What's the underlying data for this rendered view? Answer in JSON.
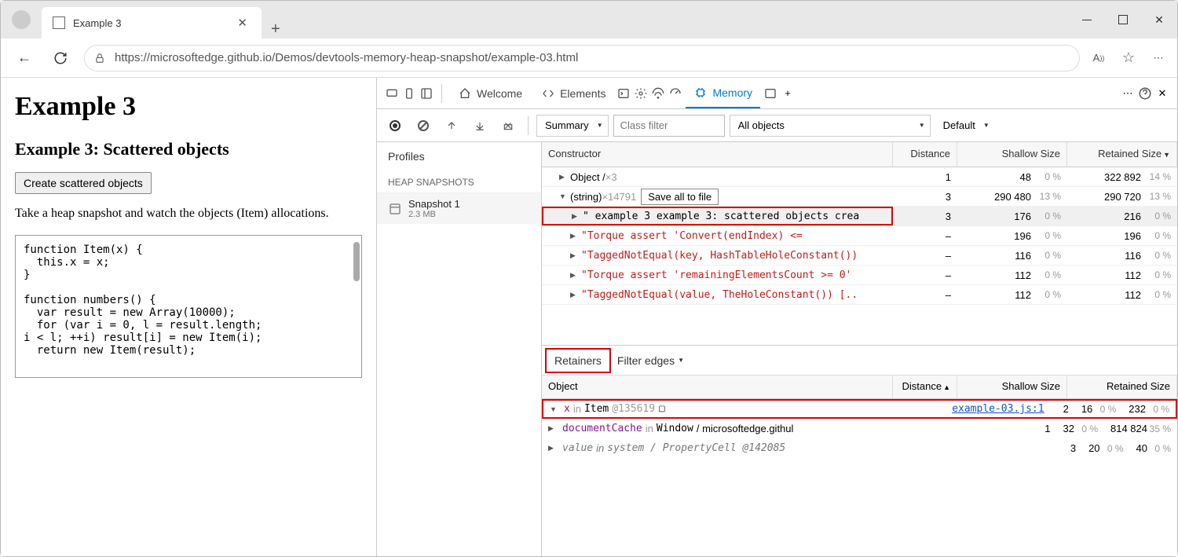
{
  "browser": {
    "tab_title": "Example 3",
    "url": "https://microsoftedge.github.io/Demos/devtools-memory-heap-snapshot/example-03.html"
  },
  "page": {
    "h1": "Example 3",
    "h2": "Example 3: Scattered objects",
    "button": "Create scattered objects",
    "paragraph": "Take a heap snapshot and watch the objects (Item) allocations.",
    "code": "function Item(x) {\n  this.x = x;\n}\n\nfunction numbers() {\n  var result = new Array(10000);\n  for (var i = 0, l = result.length;\ni < l; ++i) result[i] = new Item(i);\n  return new Item(result);"
  },
  "devtools": {
    "tabs": {
      "welcome": "Welcome",
      "elements": "Elements",
      "memory": "Memory"
    },
    "toolbar": {
      "summary": "Summary",
      "class_filter_placeholder": "Class filter",
      "all_objects": "All objects",
      "default": "Default"
    },
    "sidebar": {
      "profiles": "Profiles",
      "section": "HEAP SNAPSHOTS",
      "snapshot_name": "Snapshot 1",
      "snapshot_size": "2.3 MB"
    },
    "heap": {
      "columns": {
        "constructor": "Constructor",
        "distance": "Distance",
        "shallow": "Shallow Size",
        "retained": "Retained Size"
      },
      "save_all": "Save all to file",
      "rows": [
        {
          "indent": 1,
          "arrow": "▶",
          "label": "Object /",
          "count": "×3",
          "distance": "1",
          "shallow": "48",
          "shallow_pct": "0 %",
          "retained": "322 892",
          "retained_pct": "14 %"
        },
        {
          "indent": 1,
          "arrow": "▼",
          "label": "(string)",
          "count": "×14791",
          "hasSave": true,
          "distance": "3",
          "shallow": "290 480",
          "shallow_pct": "13 %",
          "retained": "290 720",
          "retained_pct": "13 %"
        },
        {
          "indent": 2,
          "arrow": "▶",
          "string": "\" example 3 example 3: scattered objects crea",
          "selected": true,
          "highlighted": true,
          "distance": "3",
          "shallow": "176",
          "shallow_pct": "0 %",
          "retained": "216",
          "retained_pct": "0 %"
        },
        {
          "indent": 2,
          "arrow": "▶",
          "string_red": "\"Torque assert 'Convert<uintptr>(endIndex) <=",
          "distance": "–",
          "shallow": "196",
          "shallow_pct": "0 %",
          "retained": "196",
          "retained_pct": "0 %"
        },
        {
          "indent": 2,
          "arrow": "▶",
          "string_red": "\"TaggedNotEqual(key, HashTableHoleConstant())",
          "distance": "–",
          "shallow": "116",
          "shallow_pct": "0 %",
          "retained": "116",
          "retained_pct": "0 %"
        },
        {
          "indent": 2,
          "arrow": "▶",
          "string_red": "\"Torque assert 'remainingElementsCount >= 0' ",
          "distance": "–",
          "shallow": "112",
          "shallow_pct": "0 %",
          "retained": "112",
          "retained_pct": "0 %"
        },
        {
          "indent": 2,
          "arrow": "▶",
          "string_red": "\"TaggedNotEqual(value, TheHoleConstant()) [..",
          "distance": "–",
          "shallow": "112",
          "shallow_pct": "0 %",
          "retained": "112",
          "retained_pct": "0 %"
        }
      ]
    },
    "retainers": {
      "tab": "Retainers",
      "filter": "Filter edges",
      "columns": {
        "object": "Object",
        "distance": "Distance",
        "shallow": "Shallow Size",
        "retained": "Retained Size"
      },
      "rows": [
        {
          "arrow": "▼",
          "prop": "x",
          "in": " in ",
          "type": "Item",
          "id": " @135619",
          "link": "example-03.js:1",
          "highlighted": true,
          "distance": "2",
          "shallow": "16",
          "shallow_pct": "0 %",
          "retained": "232",
          "retained_pct": "0 %"
        },
        {
          "arrow": "▶",
          "prop": "documentCache",
          "in": " in ",
          "type": "Window",
          "rest": " / microsoftedge.githul",
          "distance": "1",
          "shallow": "32",
          "shallow_pct": "0 %",
          "retained": "814 824",
          "retained_pct": "35 %"
        },
        {
          "arrow": "▶",
          "prop_gray": "value",
          "in_gray": " in ",
          "type_gray": "system / PropertyCell",
          "id_gray": " @142085",
          "gray": true,
          "distance": "3",
          "shallow": "20",
          "shallow_pct": "0 %",
          "retained": "40",
          "retained_pct": "0 %"
        }
      ]
    }
  }
}
